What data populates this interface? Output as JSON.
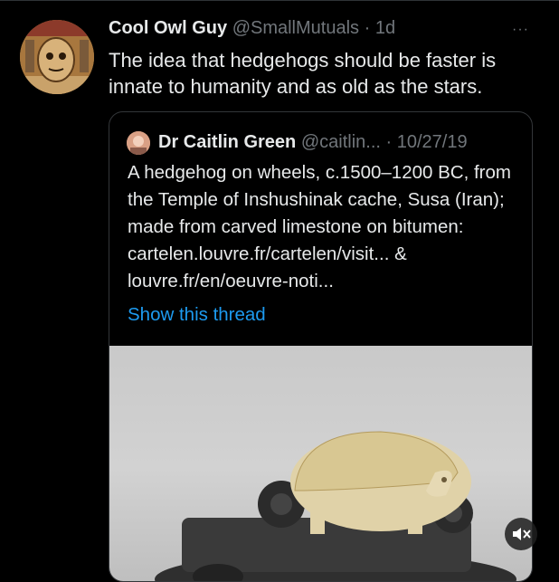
{
  "tweet": {
    "author_name": "Cool Owl Guy",
    "handle": "@SmallMutuals",
    "separator": "·",
    "time": "1d",
    "more": "···",
    "text": "The idea that hedgehogs should be faster is innate to humanity and as old as the stars."
  },
  "quoted_tweet": {
    "author_name": "Dr Caitlin Green",
    "handle": "@caitlin...",
    "separator": "·",
    "date": "10/27/19",
    "text": "A hedgehog on wheels, c.1500–1200 BC, from the Temple of Inshushinak cache, Susa (Iran); made from carved limestone on bitumen: cartelen.louvre.fr/cartelen/visit... & louvre.fr/en/oeuvre-noti...",
    "show_thread": "Show this thread"
  },
  "icons": {
    "avatar": "avatar-icon",
    "mute": "volume-muted-icon"
  },
  "colors": {
    "background": "#000000",
    "text": "#e7e9ea",
    "secondary_text": "#71767b",
    "link": "#1d9bf0",
    "border": "#333639"
  }
}
